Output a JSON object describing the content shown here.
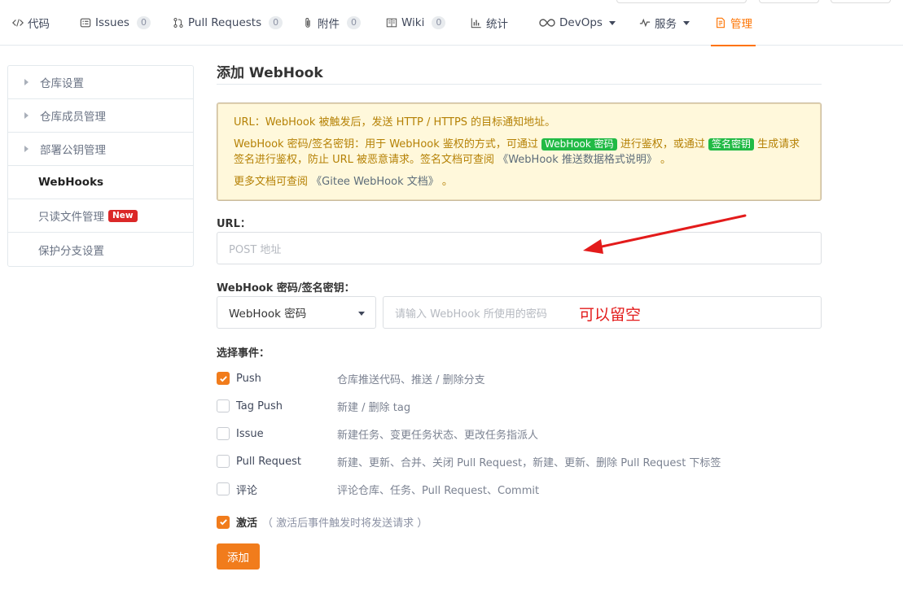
{
  "tabs": [
    {
      "label": "代码",
      "icon": "code-icon",
      "count": null
    },
    {
      "label": "Issues",
      "icon": "issues-icon",
      "count": "0"
    },
    {
      "label": "Pull Requests",
      "icon": "pull-request-icon",
      "count": "0"
    },
    {
      "label": "附件",
      "icon": "paperclip-icon",
      "count": "0"
    },
    {
      "label": "Wiki",
      "icon": "book-icon",
      "count": "0"
    },
    {
      "label": "统计",
      "icon": "bar-chart-icon",
      "count": null
    },
    {
      "label": "DevOps",
      "icon": "infinity-icon",
      "count": null
    },
    {
      "label": "服务",
      "icon": "pulse-icon",
      "count": null
    },
    {
      "label": "管理",
      "icon": "document-icon",
      "count": null
    }
  ],
  "active_tab": "管理",
  "accent_color": "#fe7300",
  "sidebar": {
    "items": [
      {
        "label": "仓库设置"
      },
      {
        "label": "仓库成员管理"
      },
      {
        "label": "部署公钥管理"
      },
      {
        "label": "WebHooks"
      },
      {
        "label": "只读文件管理",
        "badge": "New"
      },
      {
        "label": "保护分支设置"
      }
    ]
  },
  "main": {
    "title": "添加 WebHook",
    "notice": {
      "line1": "URL：WebHook 被触发后，发送 HTTP / HTTPS 的目标通知地址。",
      "line2_a": "WebHook 密码/签名密钥：用于 WebHook 鉴权的方式，可通过",
      "tag_password": "WebHook 密码",
      "line2_b": "进行鉴权，或通过",
      "tag_signature": "签名密钥",
      "line2_c": "生成请求签名进行鉴权，防止 URL 被恶意请求。签名文档可查阅",
      "line2_link": "《WebHook 推送数据格式说明》",
      "line2_end": "。",
      "line3_a": "更多文档可查阅",
      "line3_link": "《Gitee WebHook 文档》",
      "line3_end": "。"
    },
    "url_label": "URL：",
    "url_placeholder": "POST 地址",
    "secret_label": "WebHook 密码/签名密钥：",
    "secret_type": "WebHook 密码",
    "secret_placeholder": "请输入 WebHook 所使用的密码",
    "annotation": "可以留空",
    "events_label": "选择事件：",
    "events": [
      {
        "name": "Push",
        "desc": "仓库推送代码、推送 / 删除分支",
        "checked": true
      },
      {
        "name": "Tag Push",
        "desc": "新建 / 删除 tag",
        "checked": false
      },
      {
        "name": "Issue",
        "desc": "新建任务、变更任务状态、更改任务指派人",
        "checked": false
      },
      {
        "name": "Pull Request",
        "desc": "新建、更新、合并、关闭 Pull Request，新建、更新、删除 Pull Request 下标签",
        "checked": false
      },
      {
        "name": "评论",
        "desc": "评论仓库、任务、Pull Request、Commit",
        "checked": false
      }
    ],
    "activate_label": "激活",
    "activate_desc": "（ 激活后事件触发时将发送请求 ）",
    "activate_checked": true,
    "submit_label": "添加"
  }
}
